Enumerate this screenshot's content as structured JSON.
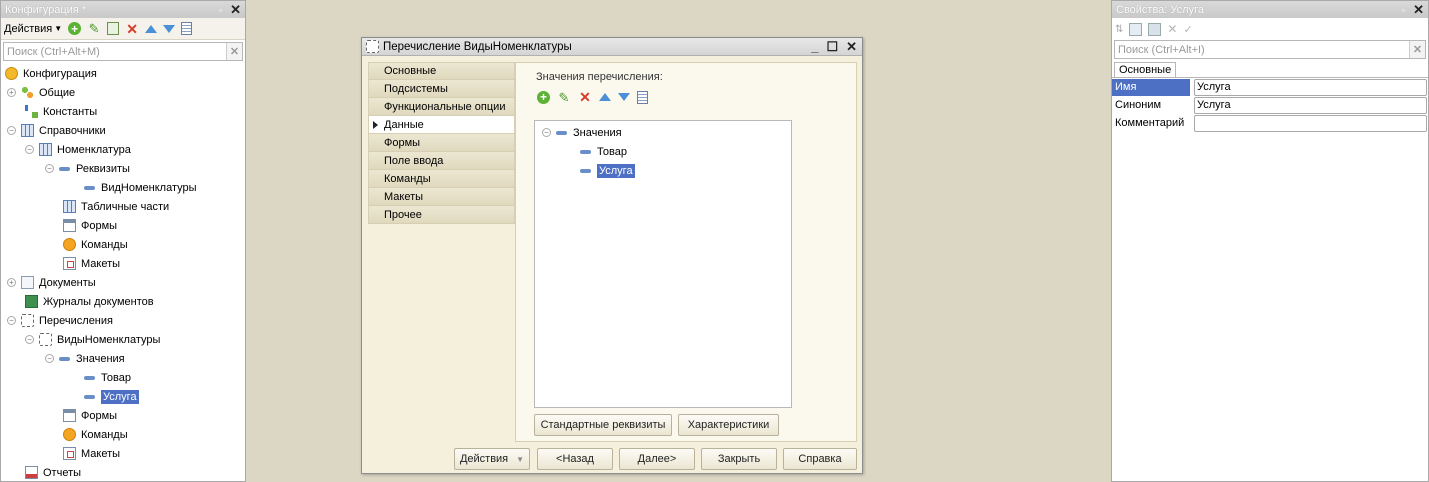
{
  "config_panel": {
    "title": "Конфигурация *",
    "actions_label": "Действия",
    "search_placeholder": "Поиск (Ctrl+Alt+M)",
    "tree": {
      "root": "Конфигурация",
      "common": "Общие",
      "constants": "Константы",
      "catalogs": "Справочники",
      "nomenclature": "Номенклатура",
      "attributes": "Реквизиты",
      "vid_nomenclatury": "ВидНоменклатуры",
      "tabular_parts": "Табличные части",
      "forms": "Формы",
      "commands": "Команды",
      "layouts": "Макеты",
      "documents": "Документы",
      "journals": "Журналы документов",
      "enums": "Перечисления",
      "enum_name": "ВидыНоменклатуры",
      "values": "Значения",
      "value_goods": "Товар",
      "value_service": "Услуга",
      "enum_forms": "Формы",
      "enum_commands": "Команды",
      "enum_layouts": "Макеты",
      "reports": "Отчеты"
    }
  },
  "dialog": {
    "title": "Перечисление ВидыНоменклатуры",
    "nav": [
      "Основные",
      "Подсистемы",
      "Функциональные опции",
      "Данные",
      "Формы",
      "Поле ввода",
      "Команды",
      "Макеты",
      "Прочее"
    ],
    "active_nav": "Данные",
    "values_label": "Значения перечисления:",
    "tree_root": "Значения",
    "tree_items": [
      "Товар",
      "Услуга"
    ],
    "btn_standard": "Стандартные реквизиты",
    "btn_characteristics": "Характеристики",
    "footer": {
      "actions": "Действия",
      "back": "<Назад",
      "next": "Далее>",
      "close": "Закрыть",
      "help": "Справка"
    }
  },
  "props_panel": {
    "title": "Свойства: Услуга",
    "search_placeholder": "Поиск (Ctrl+Alt+I)",
    "tab": "Основные",
    "rows": [
      {
        "name": "Имя",
        "value": "Услуга"
      },
      {
        "name": "Синоним",
        "value": "Услуга"
      },
      {
        "name": "Комментарий",
        "value": ""
      }
    ]
  },
  "colors": {
    "selection": "#4d6fc4",
    "desktop": "#dcd6c4"
  }
}
